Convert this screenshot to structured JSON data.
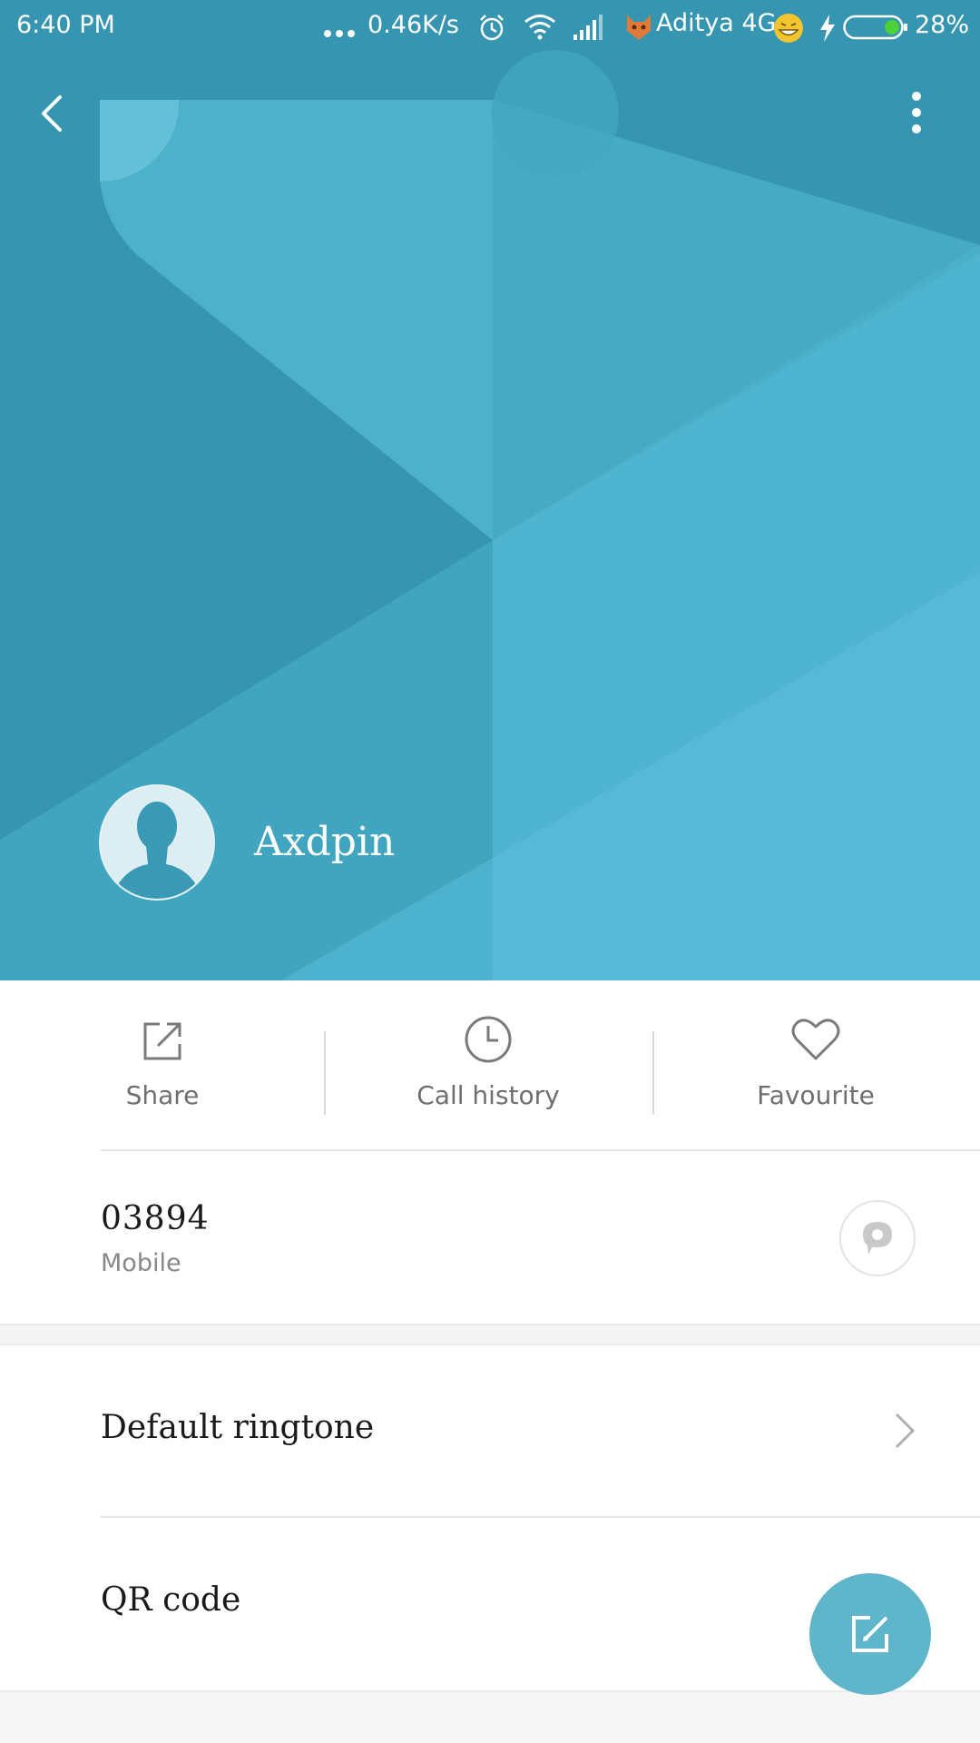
{
  "status_bar": {
    "time": "6:40 PM",
    "network_speed": "0.46K/s",
    "carrier": "Aditya 4G",
    "battery": "28%",
    "icons": [
      "dots-icon",
      "alarm-icon",
      "wifi-icon",
      "signal-icon",
      "cat-emoji-icon",
      "grin-emoji-icon",
      "charging-icon",
      "battery-icon"
    ]
  },
  "toolbar": {
    "back_icon": "chevron-left-icon",
    "more_icon": "more-vertical-icon"
  },
  "contact": {
    "name": "Axdpin",
    "avatar_icon": "person-silhouette-icon"
  },
  "actions": [
    {
      "label": "Share",
      "icon": "share-icon"
    },
    {
      "label": "Call history",
      "icon": "clock-icon"
    },
    {
      "label": "Favourite",
      "icon": "heart-icon"
    }
  ],
  "phone": {
    "number": "03894",
    "type": "Mobile",
    "message_icon": "message-bubble-icon"
  },
  "settings": [
    {
      "label": "Default ringtone",
      "icon": "chevron-right-icon"
    },
    {
      "label": "QR code"
    }
  ],
  "fab": {
    "icon": "edit-icon"
  },
  "colors": {
    "header_base": "#3696b1",
    "fab": "#5fb5c9",
    "text_primary": "#1a1a1a",
    "text_secondary": "#888888"
  }
}
